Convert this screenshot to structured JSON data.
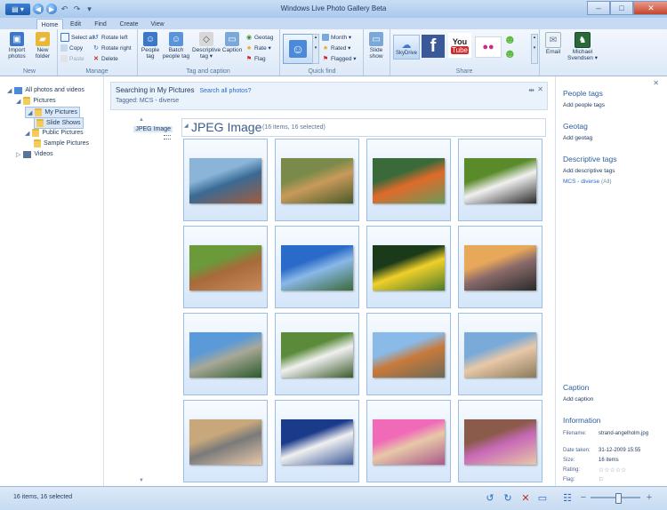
{
  "window": {
    "title": "Windows Live Photo Gallery Beta",
    "minimize": "–",
    "maximize": "□",
    "close": "✕"
  },
  "quick_access": {
    "app_menu": "▤ ▾",
    "back": "◀",
    "forward": "▶",
    "undo": "↶",
    "redo": "↷",
    "more": "▾"
  },
  "tabs": [
    "Home",
    "Edit",
    "Find",
    "Create",
    "View"
  ],
  "ribbon": {
    "new_group": {
      "label": "New",
      "import": "Import photos",
      "new_folder": "New folder"
    },
    "manage_group": {
      "label": "Manage",
      "select_all": "Select all",
      "copy": "Copy",
      "paste": "Paste",
      "rotate_left": "Rotate left",
      "rotate_right": "Rotate right",
      "delete": "Delete"
    },
    "tag_group": {
      "label": "Tag and caption",
      "people_tag": "People tag",
      "batch_people_tag": "Batch people tag",
      "descriptive_tag": "Descriptive tag ▾",
      "caption": "Caption",
      "geotag": "Geotag",
      "rate": "Rate ▾",
      "flag": "Flag"
    },
    "quick_find_group": {
      "label": "Quick find",
      "month": "Month ▾",
      "rated": "Rated ▾",
      "flagged": "Flagged ▾"
    },
    "slide_show": "Slide show",
    "share_group": {
      "label": "Share",
      "skydrive": "SkyDrive",
      "facebook": "f",
      "youtube_top": "You",
      "youtube_bottom": "Tube",
      "flickr": "●●",
      "email": "Email"
    },
    "account": {
      "name": "Michael Svendsen ▾"
    }
  },
  "nav": {
    "items": [
      {
        "label": "All photos and videos"
      },
      {
        "label": "Pictures"
      },
      {
        "label": "My Pictures"
      },
      {
        "label": "Slide Shows"
      },
      {
        "label": "Public Pictures"
      },
      {
        "label": "Sample Pictures"
      },
      {
        "label": "Videos"
      }
    ]
  },
  "search": {
    "title": "Searching in My Pictures",
    "link": "Search all photos?",
    "tagged": "Tagged:  MCS - diverse"
  },
  "timeline": {
    "label": "JPEG Image",
    "up": "▲",
    "down": "▼"
  },
  "group": {
    "title": "JPEG Image",
    "subtitle": "(16 items, 16 selected)",
    "arrow": "◢"
  },
  "photos": [
    {
      "name": "coast-sunset",
      "colors": [
        "#8ab4d8",
        "#3a6a95",
        "#a15c3c"
      ]
    },
    {
      "name": "cheetah",
      "colors": [
        "#7a8a4a",
        "#c89a5a",
        "#4a5a2a"
      ]
    },
    {
      "name": "kid-in-boat",
      "colors": [
        "#3a6a3a",
        "#e06a2a",
        "#6a9a5a"
      ]
    },
    {
      "name": "crowned-crane",
      "colors": [
        "#5a8a2a",
        "#f0f0f0",
        "#2a2a2a"
      ]
    },
    {
      "name": "alpaca",
      "colors": [
        "#6a9a3a",
        "#a86a3a",
        "#c88a5a"
      ]
    },
    {
      "name": "blue-sky-field",
      "colors": [
        "#2a6ac8",
        "#8ab8e8",
        "#3a6a3a"
      ]
    },
    {
      "name": "yellow-lilies",
      "colors": [
        "#1a3a1a",
        "#f0d02a",
        "#4a7a2a"
      ]
    },
    {
      "name": "dusk-horizon",
      "colors": [
        "#e8a85a",
        "#8a6a6a",
        "#2a2a2a"
      ]
    },
    {
      "name": "mountain-cliff",
      "colors": [
        "#5a9ad8",
        "#a8a898",
        "#2a5a2a"
      ]
    },
    {
      "name": "white-dog",
      "colors": [
        "#5a8a3a",
        "#f0f0f0",
        "#3a5a2a"
      ]
    },
    {
      "name": "playground-child",
      "colors": [
        "#8abae8",
        "#c87a3a",
        "#6a6a5a"
      ]
    },
    {
      "name": "smiling-boy",
      "colors": [
        "#7aaad8",
        "#e8c8a8",
        "#8a7a5a"
      ]
    },
    {
      "name": "knight-child",
      "colors": [
        "#c8a87a",
        "#7a7a7a",
        "#e8c8a8"
      ]
    },
    {
      "name": "windmill",
      "colors": [
        "#1a3a8a",
        "#f0f0f0",
        "#3a5a9a"
      ]
    },
    {
      "name": "pink-hair-girl",
      "colors": [
        "#f06ab8",
        "#e8c8a8",
        "#a85a8a"
      ]
    },
    {
      "name": "princess-girl",
      "colors": [
        "#8a5a4a",
        "#c86ab8",
        "#e8c8a8"
      ]
    }
  ],
  "right_pane": {
    "close": "✕",
    "people_tags": "People tags",
    "add_people_tags": "Add people tags",
    "geotag": "Geotag",
    "add_geotag": "Add geotag",
    "descriptive_tags": "Descriptive tags",
    "add_descriptive_tags": "Add descriptive tags",
    "tag_entry": "MCS - diverse",
    "tag_entry_suffix": "(All)",
    "caption": "Caption",
    "add_caption": "Add caption",
    "information": "Information",
    "filename_label": "Filename:",
    "filename": "strand-angelholm.jpg",
    "date_label": "Date taken:",
    "date": "31-12-2009  15:55",
    "size_label": "Size:",
    "size": "16 items",
    "rating_label": "Rating:",
    "rating": "☆☆☆☆☆",
    "flag_label": "Flag:",
    "flag": "⚐"
  },
  "status": {
    "text": "16 items, 16 selected",
    "rotate_left": "↺",
    "rotate_right": "↻",
    "delete": "✕",
    "slideshow": "▭",
    "view": "☷",
    "zoom_minus": "−",
    "zoom_plus": "+"
  },
  "zoom_level": 0.55
}
